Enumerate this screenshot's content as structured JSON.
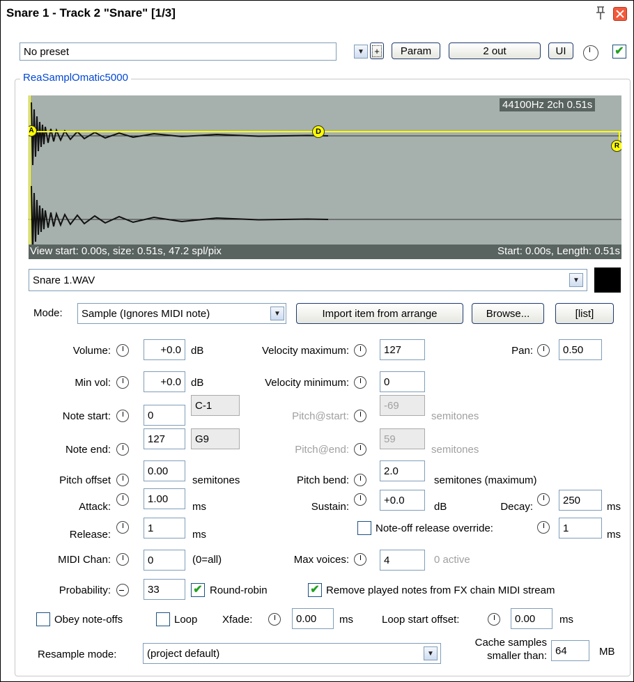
{
  "window": {
    "title": "Snare 1 - Track 2 \"Snare\" [1/3]"
  },
  "toolbar": {
    "preset_value": "No preset",
    "plus_label": "+",
    "param_label": "Param",
    "out_label": "2 out",
    "ui_label": "UI",
    "enabled_checked": true
  },
  "plugin": {
    "name": "ReaSamplOmatic5000"
  },
  "waveform": {
    "info": "44100Hz 2ch 0.51s",
    "view_info": "View start: 0.00s, size: 0.51s, 47.2 spl/pix",
    "range_info": "Start: 0.00s, Length: 0.51s",
    "marker_a": "A",
    "marker_d": "D",
    "marker_r": "R"
  },
  "file": {
    "name": "Snare 1.WAV"
  },
  "mode": {
    "label": "Mode:",
    "value": "Sample (Ignores MIDI note)",
    "import_label": "Import item from arrange",
    "browse_label": "Browse...",
    "list_label": "[list]"
  },
  "params": {
    "volume_label": "Volume:",
    "volume_value": "+0.0",
    "volume_unit": "dB",
    "velmax_label": "Velocity maximum:",
    "velmax_value": "127",
    "pan_label": "Pan:",
    "pan_value": "0.50",
    "minvol_label": "Min vol:",
    "minvol_value": "+0.0",
    "minvol_unit": "dB",
    "velmin_label": "Velocity minimum:",
    "velmin_value": "0",
    "notestart_label": "Note start:",
    "notestart_value": "0",
    "notestart_name": "C-1",
    "pitchstart_label": "Pitch@start:",
    "pitchstart_value": "-69",
    "pitchstart_unit": "semitones",
    "noteend_label": "Note end:",
    "noteend_value": "127",
    "noteend_name": "G9",
    "pitchend_label": "Pitch@end:",
    "pitchend_value": "59",
    "pitchend_unit": "semitones",
    "pitchoffset_label": "Pitch offset",
    "pitchoffset_value": "0.00",
    "pitchoffset_unit": "semitones",
    "pitchbend_label": "Pitch bend:",
    "pitchbend_value": "2.0",
    "pitchbend_unit": "semitones (maximum)",
    "attack_label": "Attack:",
    "attack_value": "1.00",
    "attack_unit": "ms",
    "sustain_label": "Sustain:",
    "sustain_value": "+0.0",
    "sustain_unit": "dB",
    "decay_label": "Decay:",
    "decay_value": "250",
    "decay_unit": "ms",
    "release_label": "Release:",
    "release_value": "1",
    "release_unit": "ms",
    "noteoff_override_label": "Note-off release override:",
    "noteoff_override_value": "1",
    "noteoff_override_unit": "ms",
    "midichan_label": "MIDI Chan:",
    "midichan_value": "0",
    "midichan_hint": "(0=all)",
    "maxvoices_label": "Max voices:",
    "maxvoices_value": "4",
    "active_text": "0 active",
    "probability_label": "Probability:",
    "probability_value": "33",
    "roundrobin_label": "Round-robin",
    "remove_notes_label": "Remove played notes from FX chain MIDI stream",
    "obey_noteoffs_label": "Obey note-offs",
    "loop_label": "Loop",
    "xfade_label": "Xfade:",
    "xfade_value": "0.00",
    "xfade_unit": "ms",
    "loopstart_label": "Loop start offset:",
    "loopstart_value": "0.00",
    "loopstart_unit": "ms",
    "resample_label": "Resample mode:",
    "resample_value": "(project default)",
    "cache_label_1": "Cache samples",
    "cache_label_2": "smaller than:",
    "cache_value": "64",
    "cache_unit": "MB"
  },
  "colors": {
    "waveform_bg": "#a6b0ad",
    "envelope_line": "#ffff00",
    "group_title": "#0046d5",
    "check_mark": "#21a121"
  }
}
